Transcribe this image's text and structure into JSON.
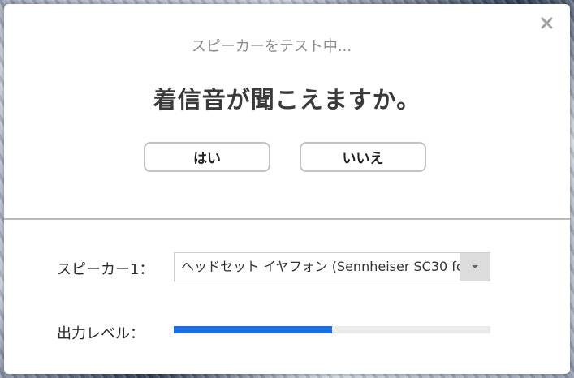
{
  "dialog": {
    "status_text": "スピーカーをテスト中...",
    "question": "着信音が聞こえますか。",
    "yes_label": "はい",
    "no_label": "いいえ",
    "close_icon": "close-icon"
  },
  "speaker": {
    "label": "スピーカー1：",
    "selected": "ヘッドセット イヤフォン (Sennheiser SC30 fo..."
  },
  "output_level": {
    "label": "出力レベル：",
    "level_percent": 50,
    "fill_color": "#1a6fe0"
  }
}
